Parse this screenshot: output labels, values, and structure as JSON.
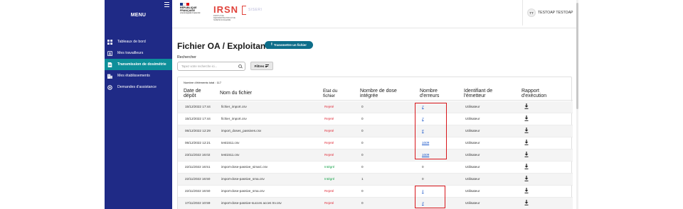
{
  "sidebar": {
    "title": "MENU",
    "items": [
      {
        "label": "Tableaux de bord",
        "icon": "dashboard-icon",
        "active": false
      },
      {
        "label": "Mes travailleurs",
        "icon": "badge-icon",
        "active": false
      },
      {
        "label": "Transmission de dosimétrie",
        "icon": "document-icon",
        "active": true
      },
      {
        "label": "Mes établissements",
        "icon": "building-icon",
        "active": false
      },
      {
        "label": "Demandes d'assistance",
        "icon": "assistance-icon",
        "active": false
      }
    ]
  },
  "header": {
    "rf_line1": "RÉPUBLIQUE",
    "rf_line2": "FRANÇAISE",
    "rf_motto": "Liberté Égalité Fraternité",
    "irsn": "IRSN",
    "irsn_subtitle": "INSTITUT DE RADIOPROTECTION ET DE SÛRETÉ NUCLÉAIRE",
    "siseri": "SISERI",
    "user_initials": "TT",
    "user_name": "TESTOAP TESTOAP"
  },
  "main": {
    "title": "Fichier OA / Exploitant",
    "transmit_button": "Transmettre un fichier",
    "search_label": "Rechercher",
    "search_placeholder": "Tapez votre recherche ici...",
    "filter_button": "Filtres",
    "count_label": "Nombre d'éléments total : 117",
    "columns": {
      "date_line1": "Date de",
      "date_line2": "dépôt",
      "file": "Nom du fichier",
      "state_line1": "Etat du",
      "state_line2": "fichier",
      "dose_line1": "Nombre de dose",
      "dose_line2": "intégrée",
      "errors_line1": "Nombre",
      "errors_line2": "d'erreurs",
      "issuer_line1": "Identifiant de",
      "issuer_line2": "l'émetteur",
      "report_line1": "Rapport",
      "report_line2": "d'exécution"
    },
    "rows": [
      {
        "date": "15/12/2022 17:44",
        "file": "fichier_import.csv",
        "state": "Rejeté",
        "doses": "0",
        "errors": "2",
        "errors_link": true,
        "issuer": "Utilisateur"
      },
      {
        "date": "15/12/2022 17:44",
        "file": "fichier_import.csv",
        "state": "Rejeté",
        "doses": "0",
        "errors": "2",
        "errors_link": true,
        "issuer": "Utilisateur"
      },
      {
        "date": "06/12/2022 12:29",
        "file": "import_doses_passives.csv",
        "state": "Rejeté",
        "doses": "0",
        "errors": "8",
        "errors_link": true,
        "issuer": "Utilisateur"
      },
      {
        "date": "06/12/2022 12:21",
        "file": "test1511.csv",
        "state": "Rejeté",
        "doses": "0",
        "errors": "1009",
        "errors_link": true,
        "issuer": "Utilisateur"
      },
      {
        "date": "23/11/2022 16:02",
        "file": "test1511.csv",
        "state": "Rejeté",
        "doses": "0",
        "errors": "1009",
        "errors_link": true,
        "issuer": "Utilisateur"
      },
      {
        "date": "22/11/2022 16:51",
        "file": "import-dose-passive_simaC.csv",
        "state": "Intégré",
        "doses": "0",
        "errors": "0",
        "errors_link": false,
        "issuer": "Utilisateur"
      },
      {
        "date": "22/11/2022 16:50",
        "file": "import-dose-passive_sma.csv",
        "state": "Intégré",
        "doses": "1",
        "errors": "0",
        "errors_link": false,
        "issuer": "Utilisateur"
      },
      {
        "date": "22/11/2022 16:50",
        "file": "import-dose-passive_sma.csv",
        "state": "Rejeté",
        "doses": "0",
        "errors": "1",
        "errors_link": true,
        "issuer": "Utilisateur"
      },
      {
        "date": "17/11/2022 10:59",
        "file": "import-dose-passive-succes acces trv.csv",
        "state": "Rejeté",
        "doses": "0",
        "errors": "3",
        "errors_link": true,
        "issuer": "Utilisateur"
      }
    ]
  },
  "colors": {
    "sidebar_bg": "#1f2a86",
    "active_item": "#0e8f9a",
    "primary_button": "#0e6e8a",
    "rejected": "#e0303d",
    "integrated": "#17a34a",
    "highlight": "#d8161b"
  }
}
